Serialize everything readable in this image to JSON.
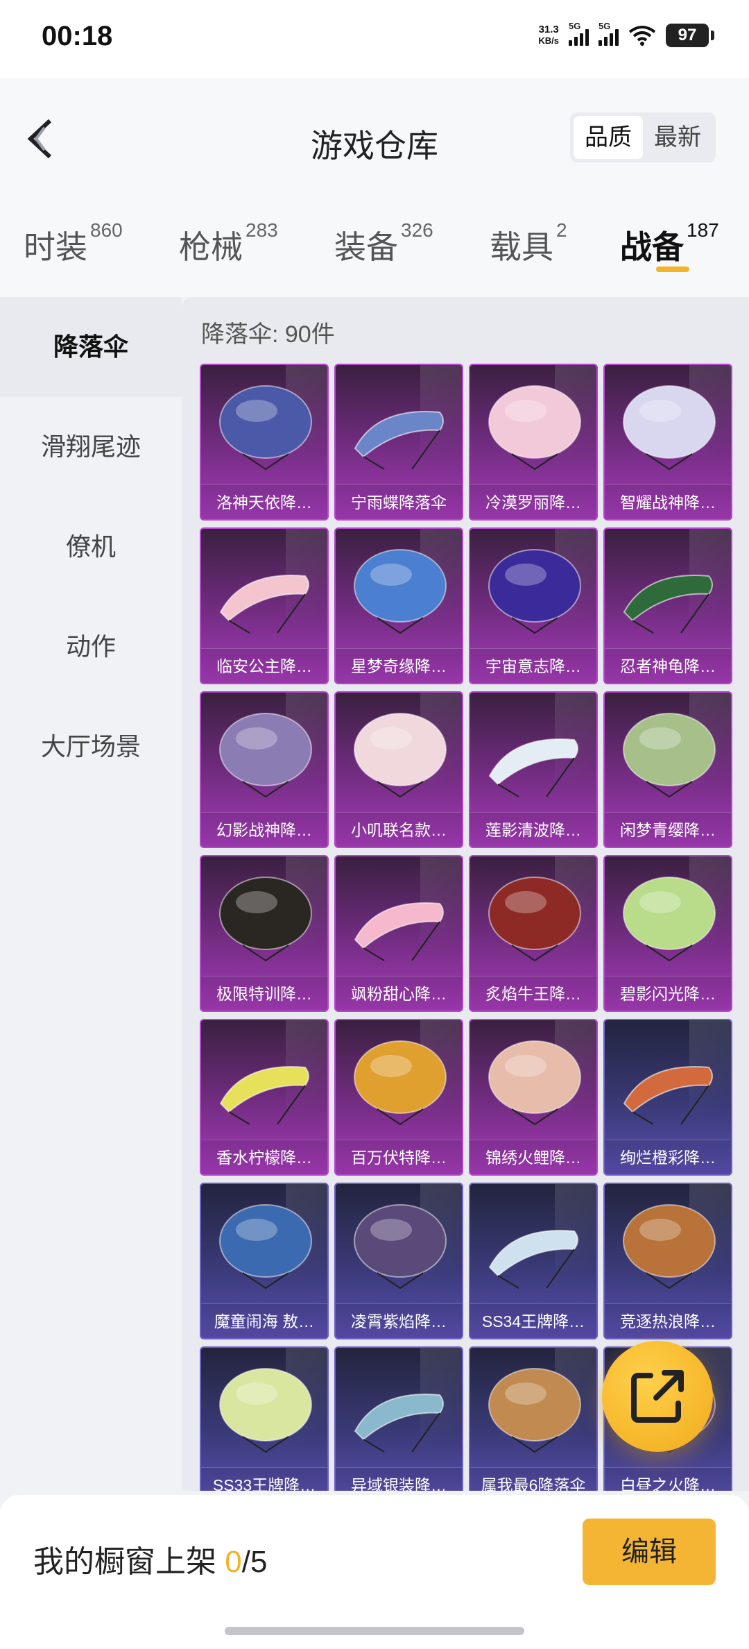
{
  "status_bar": {
    "time": "00:18",
    "net_speed_value": "31.3",
    "net_speed_unit": "KB/s",
    "signal1_label": "5G",
    "signal2_label": "5G",
    "battery": "97"
  },
  "header": {
    "title": "游戏仓库",
    "sort_options": [
      "品质",
      "最新"
    ],
    "sort_selected": "品质"
  },
  "tabs": [
    {
      "label": "时装",
      "count": "860"
    },
    {
      "label": "枪械",
      "count": "283"
    },
    {
      "label": "装备",
      "count": "326"
    },
    {
      "label": "载具",
      "count": "2"
    },
    {
      "label": "战备",
      "count": "187",
      "active": true
    }
  ],
  "sidebar": {
    "items": [
      {
        "label": "降落伞",
        "active": true
      },
      {
        "label": "滑翔尾迹"
      },
      {
        "label": "僚机"
      },
      {
        "label": "动作"
      },
      {
        "label": "大厅场景"
      }
    ]
  },
  "content": {
    "count_label": "降落伞: 90件",
    "items": [
      {
        "name": "洛神天依降…",
        "tier": "purple",
        "color": "#4a5aa8"
      },
      {
        "name": "宁雨蝶降落伞",
        "tier": "purple",
        "color": "#6a86c8"
      },
      {
        "name": "冷漠罗丽降…",
        "tier": "purple",
        "color": "#f2c9d8"
      },
      {
        "name": "智耀战神降…",
        "tier": "purple",
        "color": "#d9d6f0"
      },
      {
        "name": "临安公主降…",
        "tier": "purple",
        "color": "#f4c4cf"
      },
      {
        "name": "星梦奇缘降…",
        "tier": "purple",
        "color": "#4b7fd0"
      },
      {
        "name": "宇宙意志降…",
        "tier": "purple",
        "color": "#3a2a9a"
      },
      {
        "name": "忍者神龟降…",
        "tier": "purple",
        "color": "#2f6a3a"
      },
      {
        "name": "幻影战神降…",
        "tier": "purple",
        "color": "#8c7cb4"
      },
      {
        "name": "小叽联名款…",
        "tier": "purple",
        "color": "#f0d8dc"
      },
      {
        "name": "莲影清波降…",
        "tier": "purple",
        "color": "#e4ecf4"
      },
      {
        "name": "闲梦青缨降…",
        "tier": "purple",
        "color": "#a7c08a"
      },
      {
        "name": "极限特训降…",
        "tier": "purple",
        "color": "#2a2622"
      },
      {
        "name": "飒粉甜心降…",
        "tier": "purple",
        "color": "#f6b8cc"
      },
      {
        "name": "炙焰牛王降…",
        "tier": "purple",
        "color": "#8e2a26"
      },
      {
        "name": "碧影闪光降…",
        "tier": "purple",
        "color": "#b8dc8a"
      },
      {
        "name": "香水柠檬降…",
        "tier": "purple",
        "color": "#e6e05a"
      },
      {
        "name": "百万伏特降…",
        "tier": "purple",
        "color": "#e0a030"
      },
      {
        "name": "锦绣火鲤降…",
        "tier": "purple",
        "color": "#e8bcaa"
      },
      {
        "name": "绚烂橙彩降…",
        "tier": "blue",
        "color": "#d36a3e"
      },
      {
        "name": "魔童闹海 敖…",
        "tier": "blue",
        "color": "#3c6ab0"
      },
      {
        "name": "凌霄紫焰降…",
        "tier": "blue",
        "color": "#5a4a7a"
      },
      {
        "name": "SS34王牌降…",
        "tier": "blue",
        "color": "#cfe0ee"
      },
      {
        "name": "竞逐热浪降…",
        "tier": "blue",
        "color": "#b8723a"
      },
      {
        "name": "SS33王牌降…",
        "tier": "blue",
        "color": "#d8e6a0"
      },
      {
        "name": "异域银装降…",
        "tier": "blue",
        "color": "#8ab8cc"
      },
      {
        "name": "属我最6降落伞",
        "tier": "blue",
        "color": "#c08a50"
      },
      {
        "name": "白昼之火降…",
        "tier": "blue",
        "color": "#5a3a8a"
      }
    ]
  },
  "bottom_bar": {
    "shelf_label": "我的橱窗上架",
    "shelf_current": "0",
    "shelf_total": "/5",
    "edit_label": "编辑"
  },
  "colors": {
    "accent": "#f2b52a",
    "purple_tier": "#a43bb8",
    "blue_tier": "#5a4fb0"
  }
}
